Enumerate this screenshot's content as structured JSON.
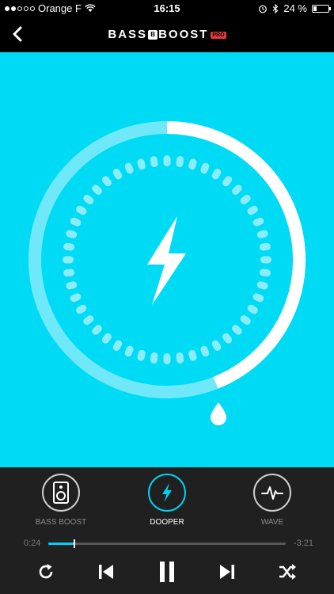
{
  "status_bar": {
    "carrier": "Orange F",
    "time": "16:15",
    "battery_text": "24 %",
    "battery_level": 0.24,
    "signal_bars_filled": 2,
    "signal_bars_total": 5
  },
  "nav": {
    "title_left": "BASS",
    "title_mid": "B",
    "title_right": "BOOST",
    "title_badge": "PRO",
    "back_icon": "chevron-left-icon"
  },
  "dial": {
    "center_icon": "lightning-bolt-icon",
    "bottom_icon": "drop-icon",
    "level": 0.44,
    "colors": {
      "background": "#00dbf5",
      "ring_track": "#6fe9fa",
      "ring_fill": "#ffffff",
      "dots": "#8cecfb"
    }
  },
  "modes": [
    {
      "label": "BASS BOOST",
      "icon": "speaker-icon",
      "active": false
    },
    {
      "label": "DOOPER",
      "icon": "lightning-bolt-icon",
      "active": true
    },
    {
      "label": "WAVE",
      "icon": "waveform-icon",
      "active": false
    }
  ],
  "player": {
    "elapsed": "0:24",
    "remaining": "-3:21",
    "progress": 0.11,
    "controls": [
      "repeat-icon",
      "previous-icon",
      "pause-icon",
      "next-icon",
      "shuffle-icon"
    ]
  },
  "colors": {
    "accent": "#00d1f2",
    "bottom_bg": "#202020"
  }
}
